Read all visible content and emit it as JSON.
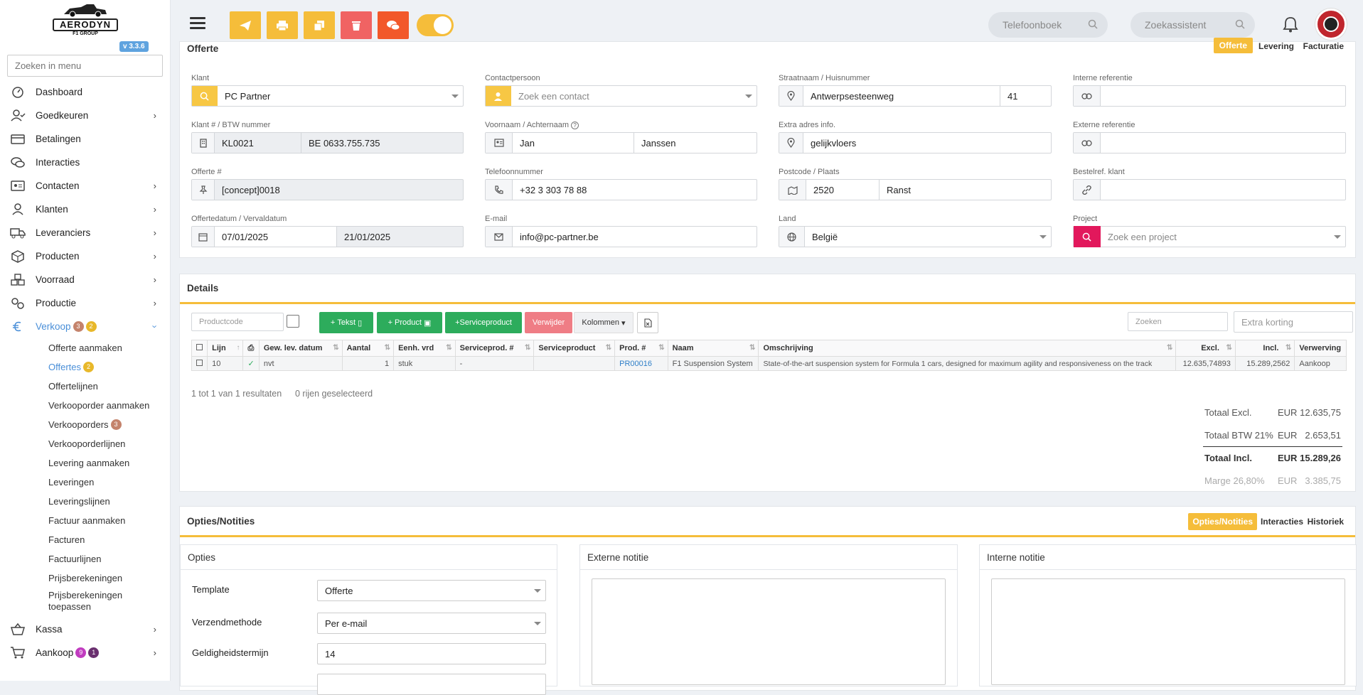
{
  "app": {
    "brand": "AERODYN",
    "brand_sub": "F1 GROUP",
    "version": "v 3.3.6"
  },
  "sidebar": {
    "search_placeholder": "Zoeken in menu",
    "items": [
      {
        "label": "Dashboard",
        "icon": "dashboard-icon",
        "has_children": false
      },
      {
        "label": "Goedkeuren",
        "icon": "user-check-icon",
        "has_children": true
      },
      {
        "label": "Betalingen",
        "icon": "credit-card-icon",
        "has_children": false
      },
      {
        "label": "Interacties",
        "icon": "chat-icon",
        "has_children": false
      },
      {
        "label": "Contacten",
        "icon": "contact-card-icon",
        "has_children": true
      },
      {
        "label": "Klanten",
        "icon": "user-icon",
        "has_children": true
      },
      {
        "label": "Leveranciers",
        "icon": "truck-icon",
        "has_children": true
      },
      {
        "label": "Producten",
        "icon": "box-icon",
        "has_children": true
      },
      {
        "label": "Voorraad",
        "icon": "boxes-icon",
        "has_children": true
      },
      {
        "label": "Productie",
        "icon": "gears-icon",
        "has_children": true
      },
      {
        "label": "Verkoop",
        "icon": "euro-icon",
        "has_children": true,
        "badges": [
          "3",
          "2"
        ]
      }
    ],
    "verkoop_sub": [
      {
        "label": "Offerte aanmaken"
      },
      {
        "label": "Offertes",
        "badge": "2"
      },
      {
        "label": "Offertelijnen"
      },
      {
        "label": "Verkooporder aanmaken"
      },
      {
        "label": "Verkooporders",
        "badge": "3"
      },
      {
        "label": "Verkooporderlijnen"
      },
      {
        "label": "Levering aanmaken"
      },
      {
        "label": "Leveringen"
      },
      {
        "label": "Leveringslijnen"
      },
      {
        "label": "Factuur aanmaken"
      },
      {
        "label": "Facturen"
      },
      {
        "label": "Factuurlijnen"
      },
      {
        "label": "Prijsberekeningen"
      },
      {
        "label": "Prijsberekeningen toepassen"
      }
    ],
    "bottom_items": [
      {
        "label": "Kassa",
        "icon": "basket-icon"
      },
      {
        "label": "Aankoop",
        "icon": "cart-icon",
        "badges": [
          "9",
          "1"
        ]
      }
    ]
  },
  "topbar": {
    "phonebook_placeholder": "Telefoonboek",
    "assistant_placeholder": "Zoekassistent",
    "toolbar_icons": [
      "send-icon",
      "print-icon",
      "copy-icon",
      "trash-icon",
      "chat-icon"
    ],
    "colors": {
      "orange": "#f5bd3a",
      "red": "#f06363",
      "deep_orange": "#f2582a"
    }
  },
  "offerte": {
    "title": "Offerte",
    "tabs": [
      "Offerte",
      "Levering",
      "Facturatie"
    ],
    "klant_label": "Klant",
    "klant_value": "PC Partner",
    "klantnr_label": "Klant # / BTW nummer",
    "klantnr": "KL0021",
    "btw": "BE 0633.755.735",
    "offertenr_label": "Offerte #",
    "offertenr": "[concept]0018",
    "datum_label": "Offertedatum / Vervaldatum",
    "datum": "07/01/2025",
    "vervaldatum": "21/01/2025",
    "contact_label": "Contactpersoon",
    "contact_placeholder": "Zoek een contact",
    "naam_label": "Voornaam / Achternaam",
    "voornaam": "Jan",
    "achternaam": "Janssen",
    "tel_label": "Telefoonnummer",
    "tel": "+32 3 303 78 88",
    "email_label": "E-mail",
    "email": "info@pc-partner.be",
    "straat_label": "Straatnaam / Huisnummer",
    "straat": "Antwerpsesteenweg",
    "huisnr": "41",
    "extra_label": "Extra adres info.",
    "extra": "gelijkvloers",
    "postcode_label": "Postcode / Plaats",
    "postcode": "2520",
    "plaats": "Ranst",
    "land_label": "Land",
    "land": "België",
    "intref_label": "Interne referentie",
    "extref_label": "Externe referentie",
    "bestelref_label": "Bestelref. klant",
    "project_label": "Project",
    "project_placeholder": "Zoek een project"
  },
  "details": {
    "title": "Details",
    "productcode_placeholder": "Productcode",
    "buttons": {
      "tekst": "Tekst",
      "product": "Product",
      "serviceproduct": "Serviceproduct",
      "verwijder": "Verwijder",
      "kolommen": "Kolommen"
    },
    "zoeken_placeholder": "Zoeken",
    "korting_placeholder": "Extra korting",
    "columns": [
      "Lijn",
      "Gew. lev. datum",
      "Aantal",
      "Eenh. vrd",
      "Serviceprod. #",
      "Serviceproduct",
      "Prod. #",
      "Naam",
      "Omschrijving",
      "Excl.",
      "Incl.",
      "Verwerving"
    ],
    "rows": [
      {
        "lijn": "10",
        "datum": "nvt",
        "aantal": "1",
        "eenheid": "stuk",
        "sp_nr": "-",
        "sp": "",
        "prod_nr": "PR00016",
        "naam": "F1 Suspension System",
        "omschrijving": "State-of-the-art suspension system for Formula 1 cars, designed for maximum agility and responsiveness on the track",
        "excl": "12.635,74893",
        "incl": "15.289,2562",
        "verwerving": "Aankoop"
      }
    ],
    "result_text": "1 tot 1 van 1 resultaten",
    "selected_text": "0 rijen geselecteerd",
    "totals": [
      {
        "label": "Totaal Excl.",
        "cur": "EUR",
        "value": "12.635,75"
      },
      {
        "label": "Totaal BTW 21%",
        "cur": "EUR",
        "value": "2.653,51"
      },
      {
        "label": "Totaal Incl.",
        "cur": "EUR",
        "value": "15.289,26"
      },
      {
        "label": "Marge 26,80%",
        "cur": "EUR",
        "value": "3.385,75"
      }
    ]
  },
  "opties_notities": {
    "title": "Opties/Notities",
    "tabs": [
      "Opties/Notities",
      "Interacties",
      "Historiek"
    ],
    "opties_title": "Opties",
    "template_label": "Template",
    "template_value": "Offerte",
    "verzend_label": "Verzendmethode",
    "verzend_value": "Per e-mail",
    "geldig_label": "Geldigheidstermijn",
    "geldig_value": "14",
    "externe_title": "Externe notitie",
    "interne_title": "Interne notitie"
  }
}
